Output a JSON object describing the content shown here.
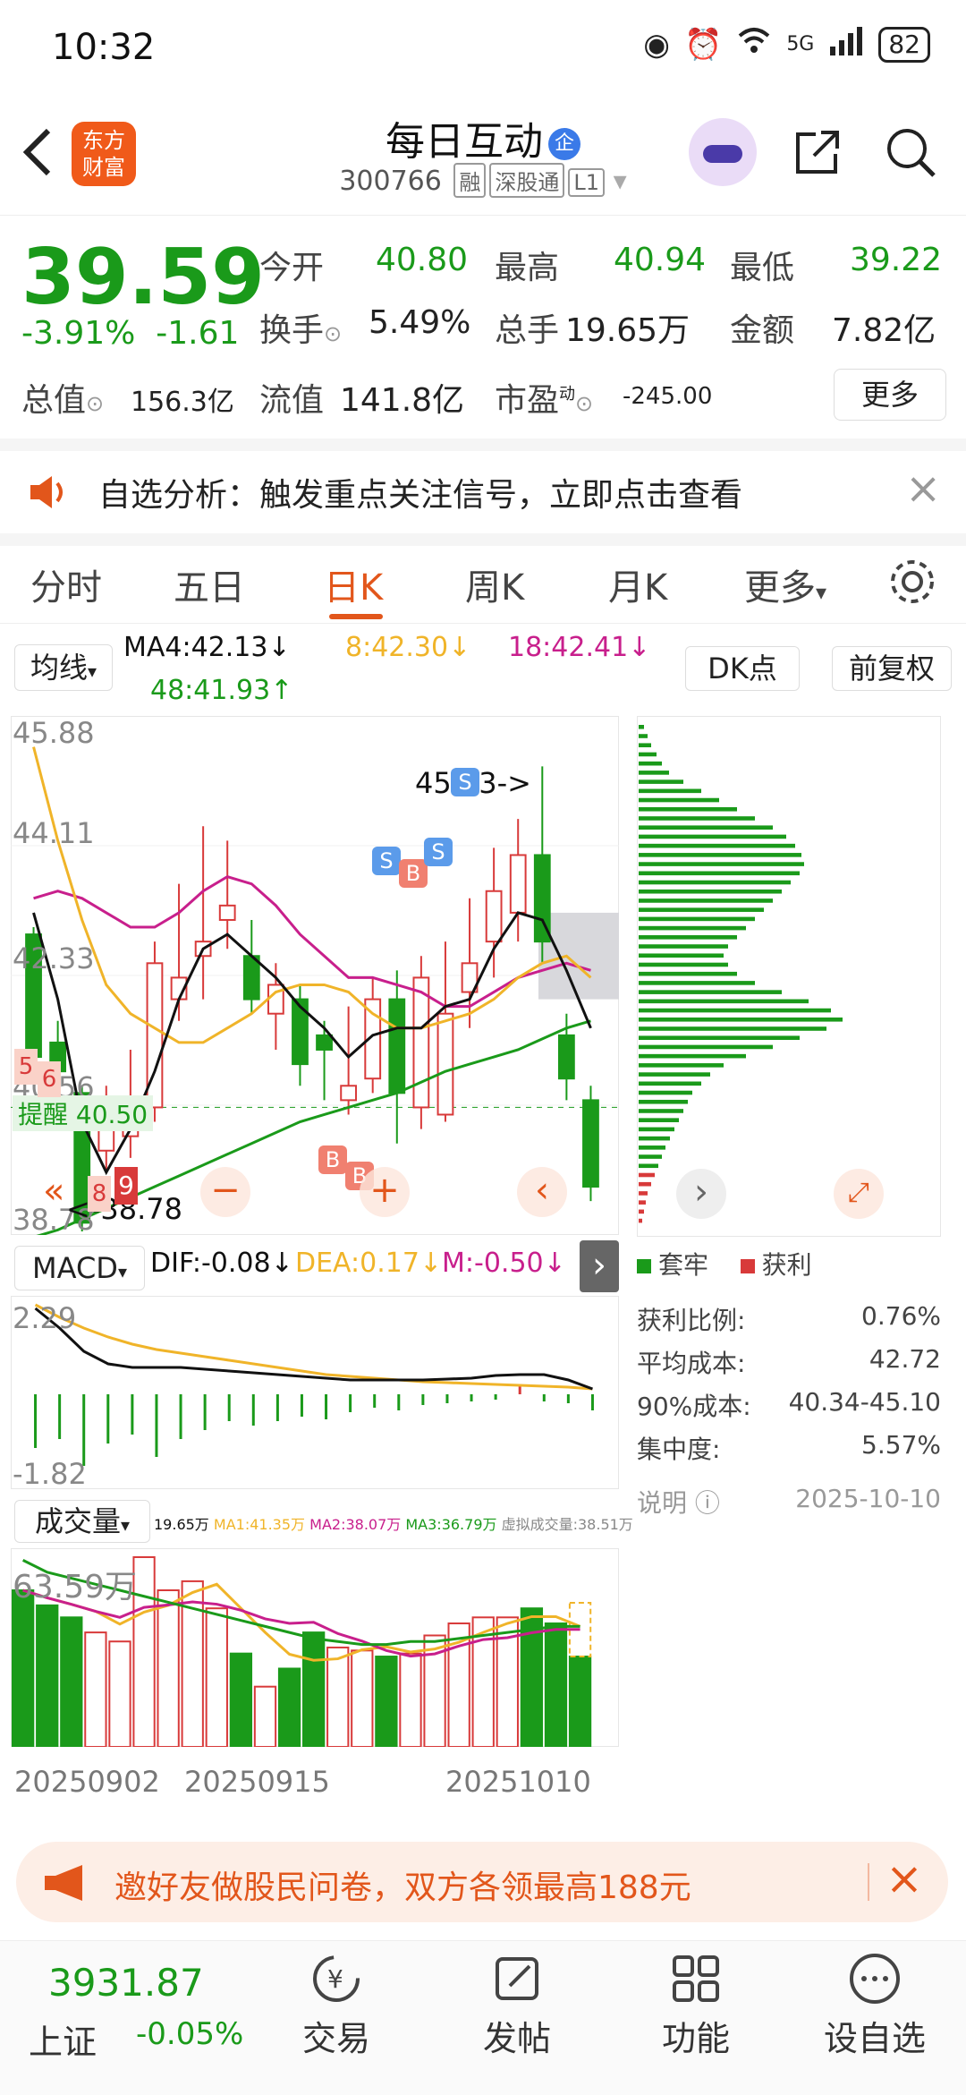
{
  "status_bar": {
    "time": "10:32",
    "battery": "82",
    "network": "5G"
  },
  "header": {
    "back": "<",
    "logo_line1": "东方",
    "logo_line2": "财富",
    "title": "每日互动",
    "title_badge": "企",
    "code": "300766",
    "tags": [
      "融",
      "深股通",
      "L1"
    ]
  },
  "quote": {
    "price": "39.59",
    "change_pct": "-3.91%",
    "change": "-1.61",
    "open_label": "今开",
    "open": "40.80",
    "high_label": "最高",
    "high": "40.94",
    "low_label": "最低",
    "low": "39.22",
    "turnover_label": "换手",
    "turnover": "5.49%",
    "volume_label": "总手",
    "volume": "19.65万",
    "amount_label": "金额",
    "amount": "7.82亿",
    "mktcap_label": "总值",
    "mktcap": "156.3亿",
    "float_label": "流值",
    "float": "141.8亿",
    "pe_label": "市盈",
    "pe_sup": "动",
    "pe": "-245.00",
    "more": "更多"
  },
  "notice": {
    "text": "自选分析：触发重点关注信号，立即点击查看"
  },
  "tabs": [
    "分时",
    "五日",
    "日K",
    "周K",
    "月K",
    "更多"
  ],
  "active_tab": 2,
  "ma_bar": {
    "selector": "均线",
    "ma4": "MA4:42.13↓",
    "ma8": "8:42.30↓",
    "ma18": "18:42.41↓",
    "ma48": "48:41.93↑",
    "dk": "DK点",
    "adjust": "前复权"
  },
  "kline": {
    "y_top": "45.88",
    "y_2": "44.11",
    "y_3": "42.33",
    "y_4": "40.56",
    "y_bottom": "38.78",
    "max_label": "45.23->",
    "min_label": "<-38.78",
    "alert_label": "提醒",
    "alert_value": "40.50",
    "seq_labels": [
      "5",
      "6",
      "8",
      "9"
    ],
    "buy_label": "B",
    "sell_label": "S"
  },
  "chart_data": {
    "type": "candlestick",
    "ylim": [
      38.78,
      45.88
    ],
    "candles": [
      {
        "o": 42.9,
        "c": 41.2,
        "h": 43.0,
        "l": 40.9
      },
      {
        "o": 41.4,
        "c": 41.0,
        "h": 41.7,
        "l": 40.5
      },
      {
        "o": 40.7,
        "c": 38.9,
        "h": 40.8,
        "l": 38.78
      },
      {
        "o": 39.9,
        "c": 40.4,
        "h": 40.8,
        "l": 39.6
      },
      {
        "o": 40.1,
        "c": 40.5,
        "h": 41.3,
        "l": 39.8
      },
      {
        "o": 40.5,
        "c": 42.5,
        "h": 42.8,
        "l": 40.3
      },
      {
        "o": 42.0,
        "c": 42.3,
        "h": 43.6,
        "l": 41.7
      },
      {
        "o": 42.6,
        "c": 42.8,
        "h": 44.4,
        "l": 42.0
      },
      {
        "o": 43.1,
        "c": 43.3,
        "h": 44.2,
        "l": 42.7
      },
      {
        "o": 42.6,
        "c": 42.0,
        "h": 43.1,
        "l": 41.8
      },
      {
        "o": 41.8,
        "c": 42.2,
        "h": 42.5,
        "l": 41.3
      },
      {
        "o": 42.0,
        "c": 41.1,
        "h": 42.2,
        "l": 40.8
      },
      {
        "o": 41.5,
        "c": 41.3,
        "h": 41.7,
        "l": 40.6
      },
      {
        "o": 40.6,
        "c": 40.8,
        "h": 41.9,
        "l": 40.4
      },
      {
        "o": 40.9,
        "c": 42.0,
        "h": 42.3,
        "l": 40.7
      },
      {
        "o": 42.0,
        "c": 40.7,
        "h": 42.4,
        "l": 40.0
      },
      {
        "o": 40.5,
        "c": 42.3,
        "h": 42.6,
        "l": 40.2
      },
      {
        "o": 40.4,
        "c": 41.8,
        "h": 42.8,
        "l": 40.3
      },
      {
        "o": 42.1,
        "c": 42.5,
        "h": 43.4,
        "l": 41.6
      },
      {
        "o": 42.8,
        "c": 43.5,
        "h": 44.1,
        "l": 42.3
      },
      {
        "o": 43.2,
        "c": 44.0,
        "h": 44.5,
        "l": 42.8
      },
      {
        "o": 44.0,
        "c": 42.8,
        "h": 45.23,
        "l": 42.5
      },
      {
        "o": 41.5,
        "c": 40.9,
        "h": 41.8,
        "l": 40.6
      },
      {
        "o": 40.6,
        "c": 39.4,
        "h": 40.8,
        "l": 39.2
      }
    ],
    "ma_lines": {
      "ma4": [
        43.2,
        42.0,
        40.3,
        39.6,
        40.2,
        41.0,
        42.0,
        42.7,
        42.9,
        42.6,
        42.3,
        41.9,
        41.6,
        41.2,
        41.5,
        41.6,
        41.6,
        41.9,
        42.0,
        42.7,
        43.2,
        43.1,
        42.4,
        41.6
      ],
      "ma8": [
        45.5,
        44.2,
        43.1,
        42.2,
        41.8,
        41.6,
        41.4,
        41.4,
        41.6,
        41.8,
        42.1,
        42.2,
        42.2,
        42.1,
        41.8,
        41.6,
        41.6,
        41.7,
        41.8,
        42.0,
        42.3,
        42.5,
        42.6,
        42.3
      ],
      "ma18": [
        43.4,
        43.5,
        43.4,
        43.2,
        43.0,
        43.0,
        43.2,
        43.5,
        43.7,
        43.6,
        43.3,
        42.9,
        42.6,
        42.3,
        42.3,
        42.2,
        42.1,
        41.9,
        41.9,
        42.1,
        42.3,
        42.4,
        42.5,
        42.4
      ],
      "ma48": [
        38.7,
        38.8,
        38.95,
        39.1,
        39.25,
        39.4,
        39.55,
        39.7,
        39.85,
        40.0,
        40.15,
        40.3,
        40.4,
        40.5,
        40.6,
        40.7,
        40.85,
        41.0,
        41.1,
        41.2,
        41.3,
        41.45,
        41.6,
        41.7
      ]
    },
    "macd": {
      "dif": "DIF:-0.08↓",
      "dea": "DEA:0.17↓",
      "m": "M:-0.50↓",
      "ymax": "2.29",
      "ymin": "-1.82"
    },
    "volume": {
      "ymax": "63.59万",
      "total": "19.65万",
      "ma1": "MA1:41.35万",
      "ma2": "MA2:38.07万",
      "ma3": "MA3:36.79万",
      "virtual": "虚拟成交量:38.51万",
      "values": [
        52,
        47,
        43,
        38,
        35,
        63,
        52,
        55,
        46,
        31,
        20,
        26,
        38,
        33,
        32,
        30,
        31,
        37,
        41,
        43,
        43,
        46,
        41,
        30
      ]
    },
    "dates": [
      "20250902",
      "20250915",
      "20251010"
    ]
  },
  "macd_selector": "MACD",
  "vol_selector": "成交量",
  "chips": {
    "legend_trapped": "套牢",
    "legend_profit": "获利",
    "rows": [
      {
        "label": "获利比例:",
        "value": "0.76%"
      },
      {
        "label": "平均成本:",
        "value": "42.72"
      },
      {
        "label": "90%成本:",
        "value": "40.34-45.10"
      },
      {
        "label": "集中度:",
        "value": "5.57%"
      }
    ],
    "note_label": "说明",
    "date": "2025-10-10"
  },
  "banner": {
    "text": "邀好友做股民问卷，双方各领最高188元"
  },
  "bottom_nav": {
    "index_value": "3931.87",
    "index_name": "上证",
    "index_change": "-0.05%",
    "items": [
      "交易",
      "发帖",
      "功能",
      "设自选"
    ]
  },
  "colors": {
    "up": "#d83a3a",
    "down": "#1a9a1a",
    "accent": "#e2561b",
    "ma4": "#111111",
    "ma8": "#f0b429",
    "ma18": "#c81f8c",
    "ma48": "#1a9a1a"
  }
}
